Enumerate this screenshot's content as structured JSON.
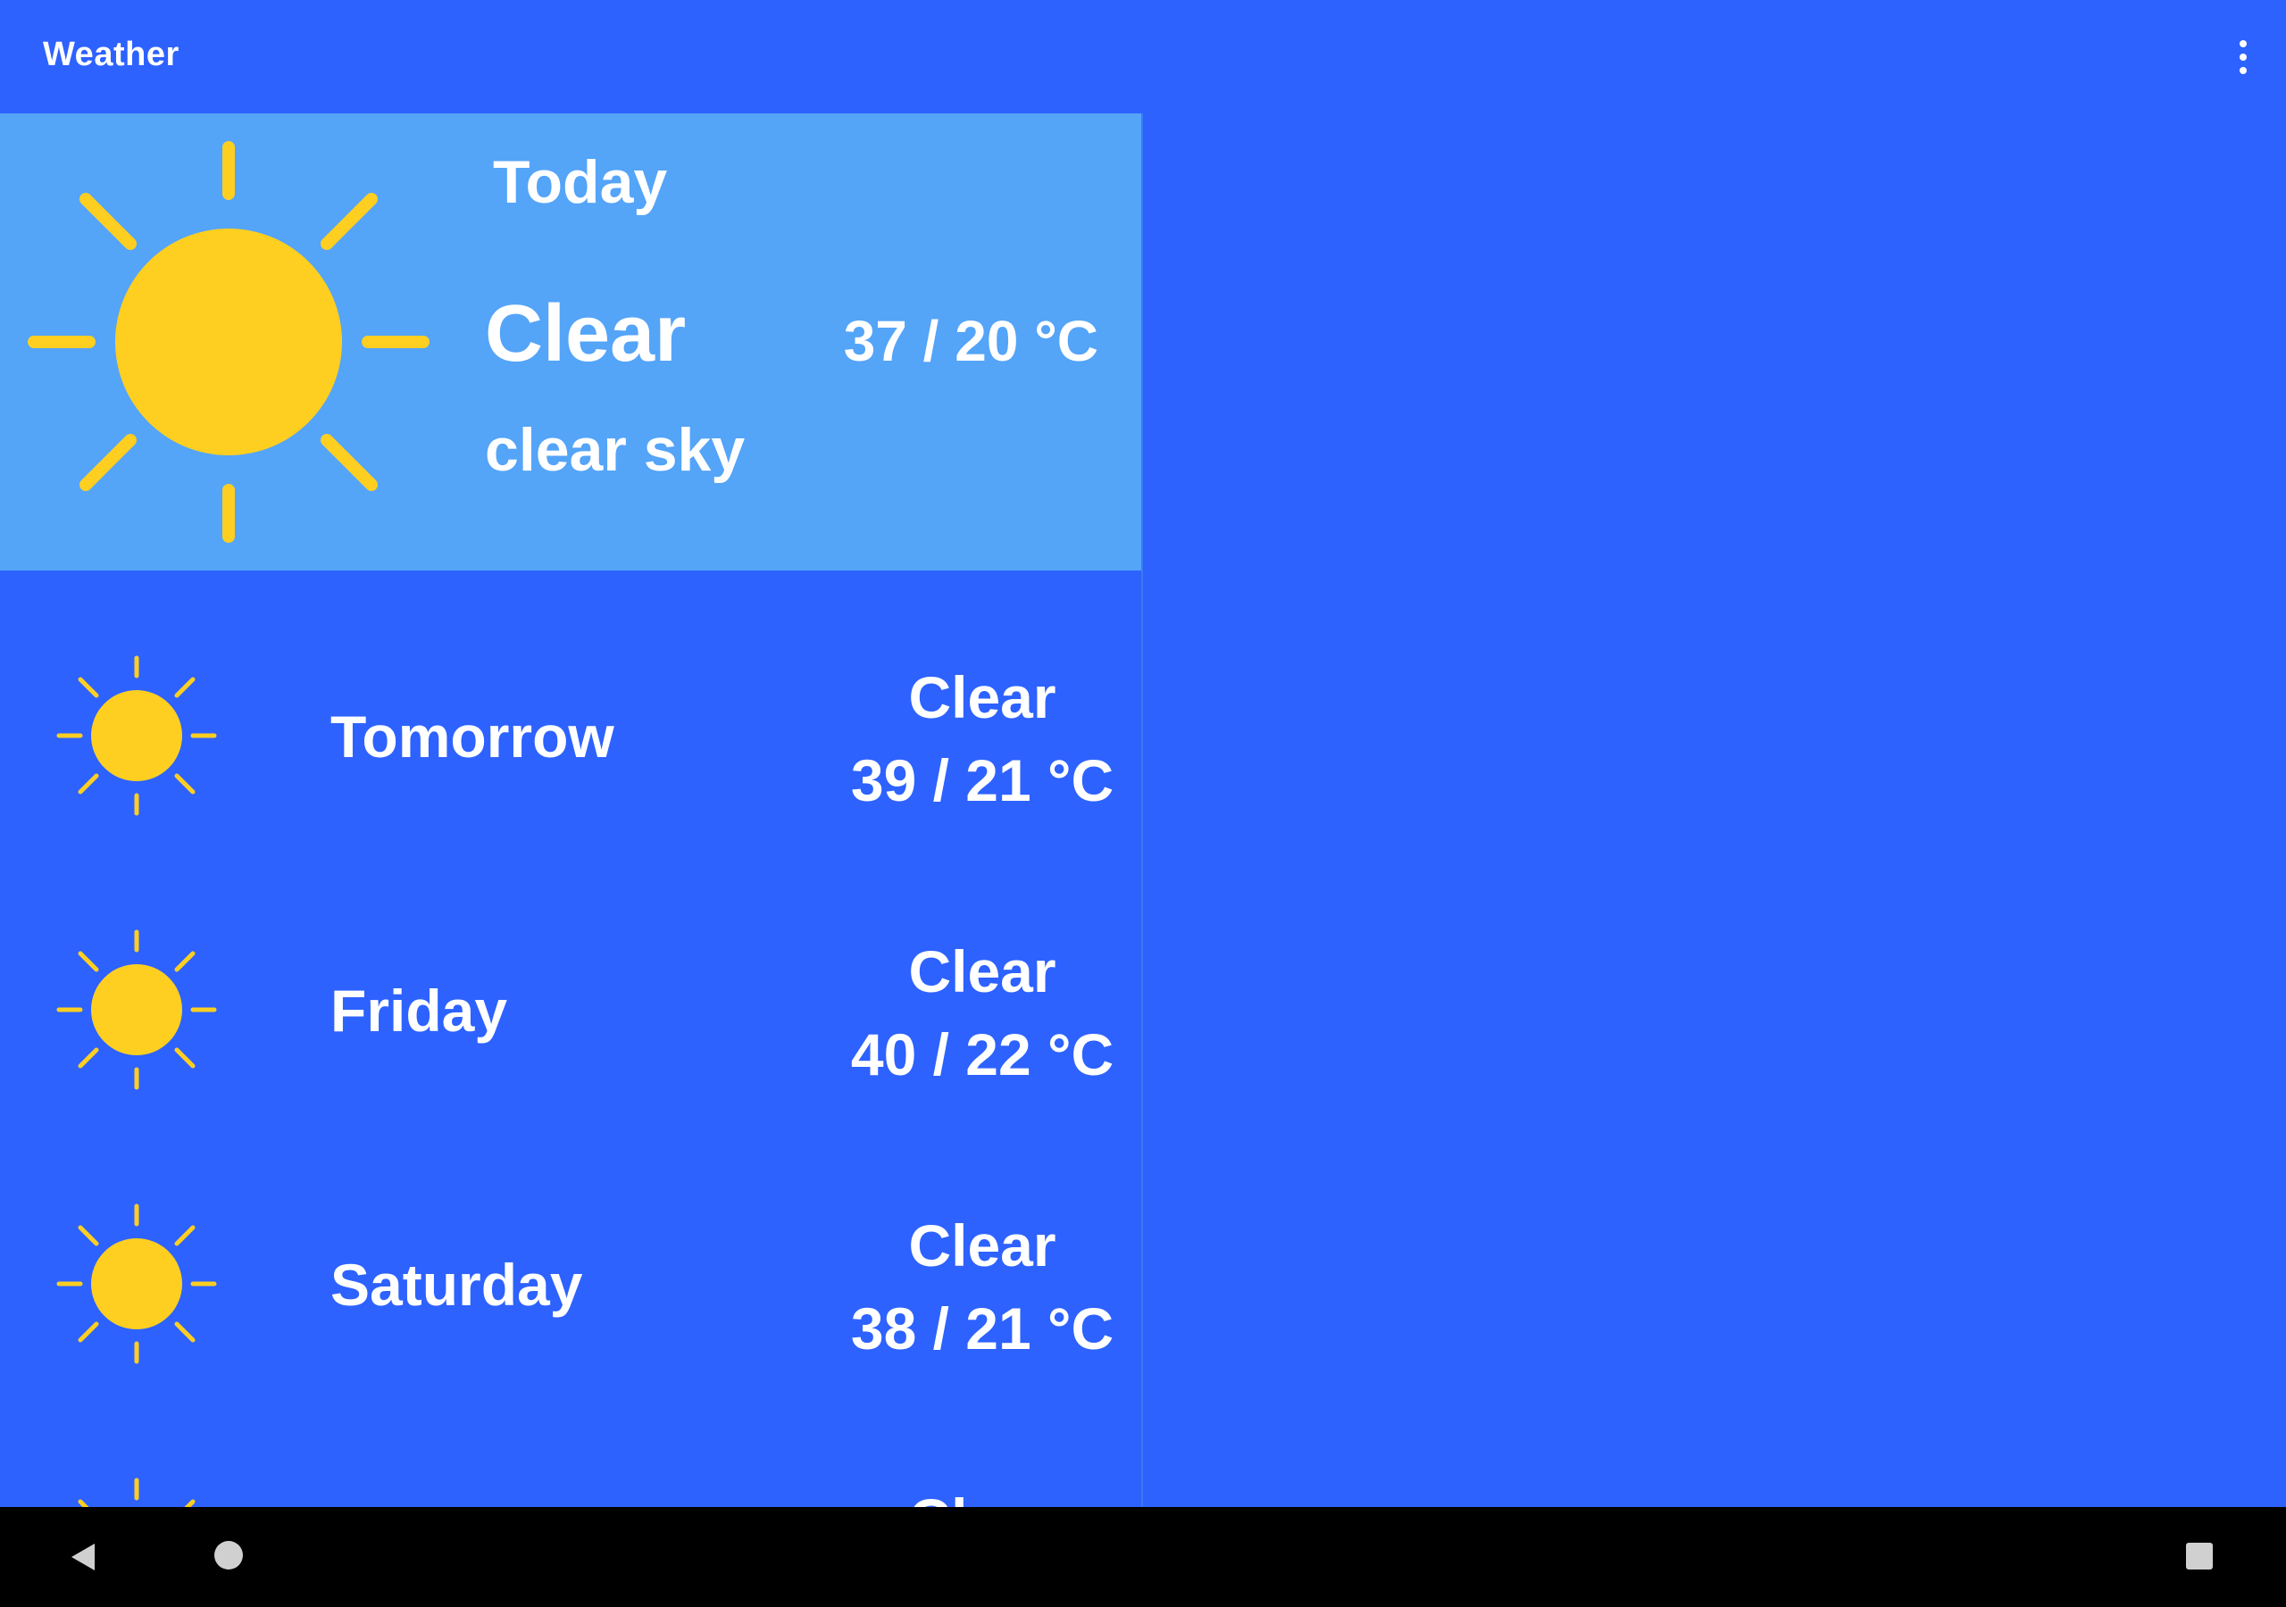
{
  "toolbar": {
    "title": "Weather",
    "overflow_icon": "more-vert-icon"
  },
  "colors": {
    "background": "#2d62ff",
    "today_card": "#54a4f8",
    "sun": "#fecf21",
    "text": "#ffffff",
    "nav_bar": "#000000"
  },
  "today": {
    "day": "Today",
    "main": "Clear",
    "description": "clear sky",
    "temperature": "37 / 20 °C",
    "icon": "sun-icon"
  },
  "forecast": [
    {
      "day": "Tomorrow",
      "main": "Clear",
      "temperature": "39 / 21 °C",
      "icon": "sun-icon"
    },
    {
      "day": "Friday",
      "main": "Clear",
      "temperature": "40 / 22 °C",
      "icon": "sun-icon"
    },
    {
      "day": "Saturday",
      "main": "Clear",
      "temperature": "38 / 21 °C",
      "icon": "sun-icon"
    },
    {
      "day": "",
      "main": "Clear",
      "temperature": "",
      "icon": "sun-icon"
    }
  ],
  "navigation": {
    "back_icon": "back-triangle-icon",
    "home_icon": "home-circle-icon",
    "recents_icon": "recents-square-icon"
  }
}
